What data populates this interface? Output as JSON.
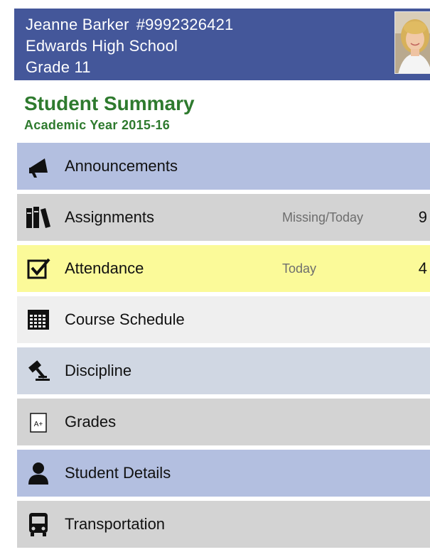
{
  "student": {
    "name": "Jeanne Barker",
    "id": "#9992326421",
    "school": "Edwards High School",
    "grade": "Grade 11"
  },
  "summary": {
    "title": "Student Summary",
    "subtitle": "Academic Year 2015-16"
  },
  "colors": {
    "header_bg": "#44579a",
    "title_green": "#2e7a2e",
    "row_blue": "#b3bfe0",
    "row_gray": "#d3d3d3",
    "row_yellow": "#fbfa99",
    "row_light": "#efefef",
    "row_slate": "#d0d7e3"
  },
  "menu": [
    {
      "label": "Announcements",
      "sub": "",
      "count": "",
      "icon": "megaphone-icon",
      "color": "#b3bfe0"
    },
    {
      "label": "Assignments",
      "sub": "Missing/Today",
      "count": "9",
      "icon": "books-icon",
      "color": "#d3d3d3"
    },
    {
      "label": "Attendance",
      "sub": "Today",
      "count": "4",
      "icon": "checkbox-icon",
      "color": "#fbfa99"
    },
    {
      "label": "Course Schedule",
      "sub": "",
      "count": "",
      "icon": "calendar-icon",
      "color": "#efefef"
    },
    {
      "label": "Discipline",
      "sub": "",
      "count": "",
      "icon": "gavel-icon",
      "color": "#d0d7e3"
    },
    {
      "label": "Grades",
      "sub": "",
      "count": "",
      "icon": "grade-a-plus-icon",
      "color": "#d3d3d3"
    },
    {
      "label": "Student Details",
      "sub": "",
      "count": "",
      "icon": "person-icon",
      "color": "#b3bfe0"
    },
    {
      "label": "Transportation",
      "sub": "",
      "count": "",
      "icon": "bus-icon",
      "color": "#d3d3d3"
    }
  ]
}
